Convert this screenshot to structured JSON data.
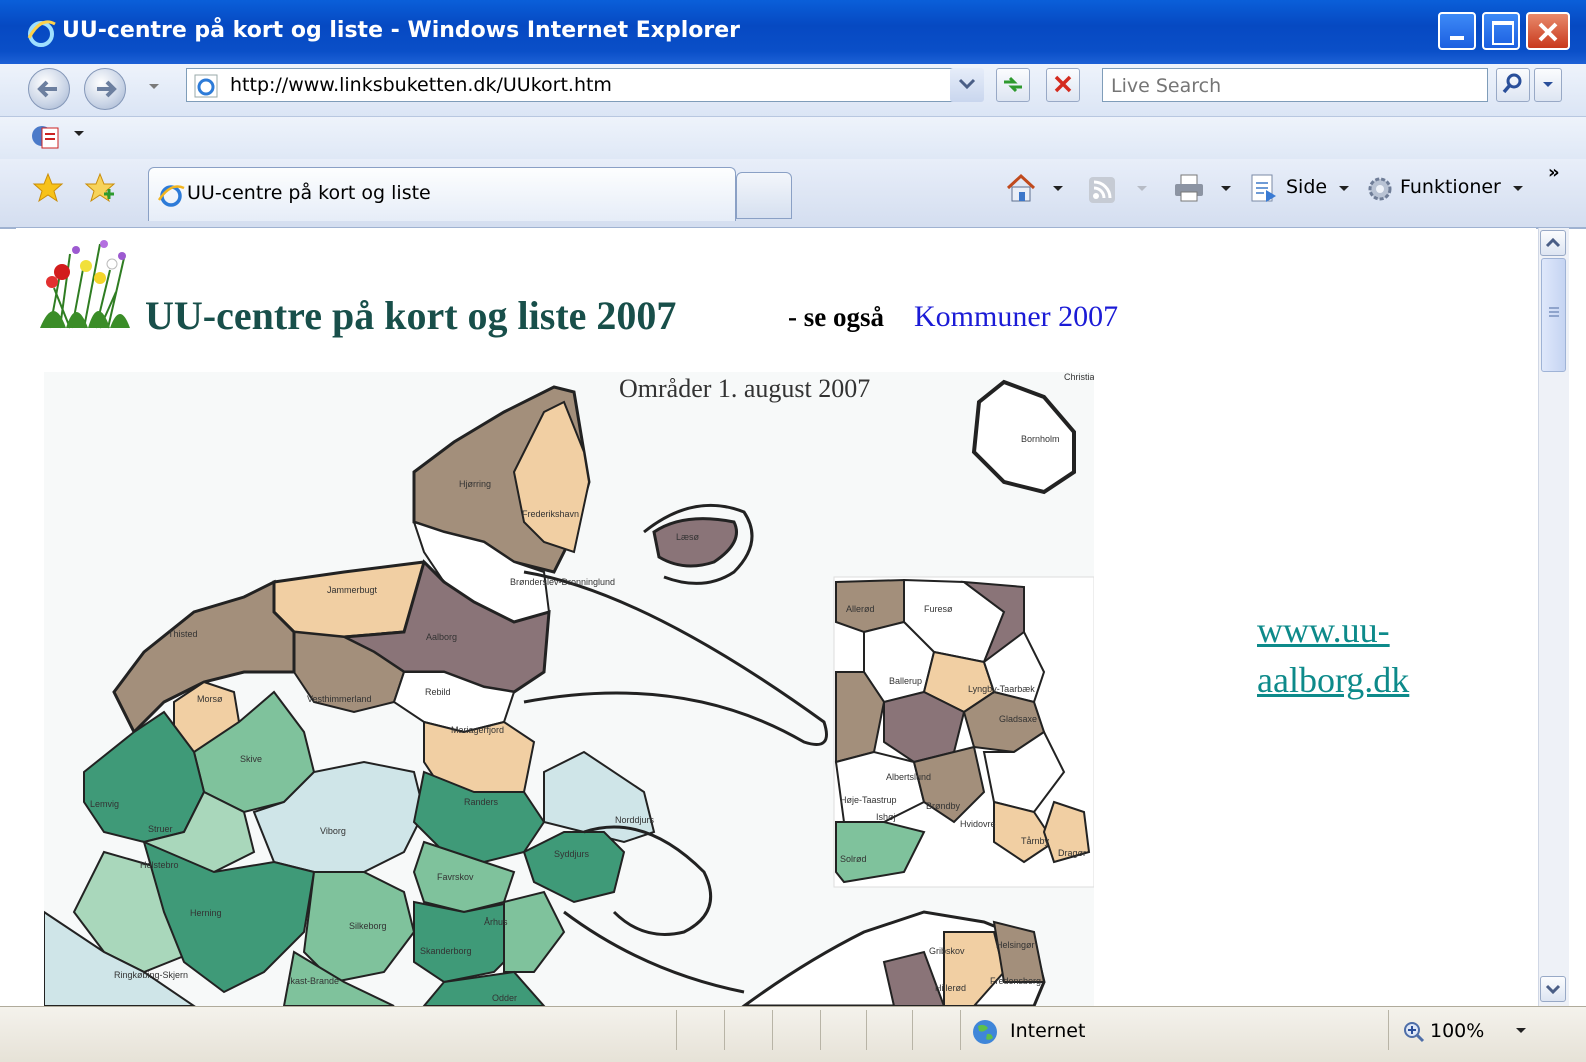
{
  "window": {
    "title": "UU-centre på kort og liste - Windows Internet Explorer"
  },
  "address_bar": {
    "url": "http://www.linksbuketten.dk/UUkort.htm"
  },
  "search": {
    "placeholder": "Live Search"
  },
  "tabs": [
    {
      "label": "UU-centre på kort og liste"
    }
  ],
  "command_bar": {
    "page_label": "Side",
    "tools_label": "Funktioner",
    "more": "»"
  },
  "page": {
    "title": "UU-centre på kort og liste 2007",
    "see_also": "- se også",
    "see_also_link": "Kommuner 2007",
    "side_link_line1": "www.uu-",
    "side_link_line2": "aalborg.dk"
  },
  "map": {
    "title": "Områder 1. august 2007",
    "labels": [
      "Bornholm",
      "Hjørring",
      "Frederikshavn",
      "Læsø",
      "Brønderslev-Dronninglund",
      "Jammerbugt",
      "Thisted",
      "Aalborg",
      "Morsø",
      "Vesthimmerland",
      "Rebild",
      "Mariagerfjord",
      "Skive",
      "Lemvig",
      "Struer",
      "Randers",
      "Viborg",
      "Norddjurs",
      "Syddjurs",
      "Holstebro",
      "Favrskov",
      "Herning",
      "Silkeborg",
      "Århus",
      "Skanderborg",
      "Ringkøbing-Skjern",
      "Ikast-Brande",
      "Odder",
      "Gribskov",
      "Helsingør",
      "Fredensborg",
      "Hillerød",
      "Allerød",
      "Furesø",
      "Lyngby-Taarbæk",
      "Gladsaxe",
      "Ballerup",
      "Albertslund",
      "Høje-Taastrup",
      "Ishøj",
      "Brøndby",
      "Hvidovre",
      "Tårnby",
      "Dragør",
      "Solrød",
      "Christiansø"
    ],
    "colors": {
      "brown": "#a38f7b",
      "mauve": "#8a7478",
      "tan": "#f1cfa3",
      "green_dark": "#3f9a78",
      "green_mid": "#7fc29c",
      "green_light": "#a9d7bb",
      "blue_pale": "#cfe5e8"
    }
  },
  "status": {
    "zone": "Internet",
    "zoom": "100%"
  }
}
